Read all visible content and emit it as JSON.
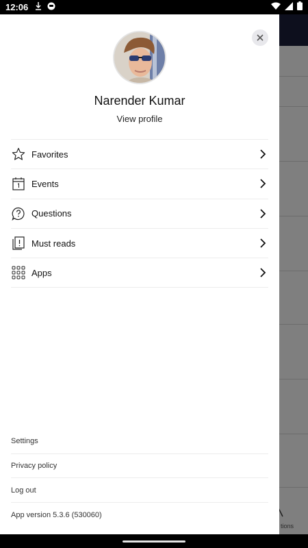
{
  "status_bar": {
    "time": "12:06",
    "left_icons": [
      "download-icon",
      "app-notification-icon"
    ],
    "right_icons": [
      "wifi-icon",
      "cell-signal-icon",
      "battery-icon"
    ]
  },
  "background": {
    "partial_tab_label": "tions"
  },
  "drawer": {
    "profile": {
      "name": "Narender Kumar",
      "view_profile_label": "View profile"
    },
    "menu": [
      {
        "label": "Favorites",
        "icon": "star-icon"
      },
      {
        "label": "Events",
        "icon": "calendar-icon"
      },
      {
        "label": "Questions",
        "icon": "question-bubble-icon"
      },
      {
        "label": "Must reads",
        "icon": "must-read-icon"
      },
      {
        "label": "Apps",
        "icon": "apps-grid-icon"
      }
    ],
    "footer": {
      "settings": "Settings",
      "privacy_policy": "Privacy policy",
      "log_out": "Log out",
      "app_version": "App version 5.3.6 (530060)"
    }
  },
  "colors": {
    "header_dark": "#1a1f3a",
    "divider": "#ececec",
    "text": "#111111"
  }
}
